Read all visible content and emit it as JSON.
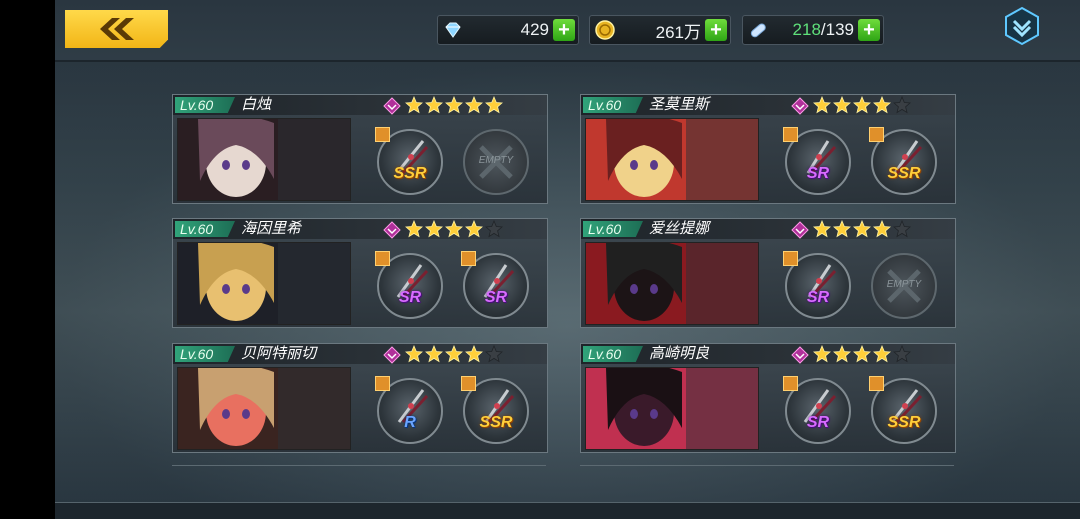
{
  "header": {
    "back_label": "",
    "resources": [
      {
        "icon": "diamond-icon",
        "value": "429"
      },
      {
        "icon": "gold-coin-icon",
        "value": "261万"
      },
      {
        "icon": "stamina-capsule-icon",
        "current": "218",
        "max": "/139"
      }
    ]
  },
  "characters": [
    {
      "level": "Lv.60",
      "name": "白烛",
      "stars": 5,
      "weapons": [
        {
          "rarity": "SSR"
        },
        {
          "rarity": "EMPTY"
        }
      ]
    },
    {
      "level": "Lv.60",
      "name": "圣莫里斯",
      "stars": 4,
      "weapons": [
        {
          "rarity": "SR"
        },
        {
          "rarity": "SSR"
        }
      ]
    },
    {
      "level": "Lv.60",
      "name": "海因里希",
      "stars": 4,
      "weapons": [
        {
          "rarity": "SR"
        },
        {
          "rarity": "SR"
        }
      ]
    },
    {
      "level": "Lv.60",
      "name": "爱丝提娜",
      "stars": 4,
      "weapons": [
        {
          "rarity": "SR"
        },
        {
          "rarity": "EMPTY"
        }
      ]
    },
    {
      "level": "Lv.60",
      "name": "贝阿特丽切",
      "stars": 4,
      "weapons": [
        {
          "rarity": "R"
        },
        {
          "rarity": "SSR"
        }
      ]
    },
    {
      "level": "Lv.60",
      "name": "高崎明良",
      "stars": 4,
      "weapons": [
        {
          "rarity": "SR"
        },
        {
          "rarity": "SSR"
        }
      ]
    }
  ],
  "colors": {
    "accent": "#f2b516",
    "level_bg": "#31a37a",
    "star_gold": "#ffcf3a",
    "ssr": "#ffcf3a",
    "sr": "#d86cff",
    "r": "#6aa4ff"
  }
}
